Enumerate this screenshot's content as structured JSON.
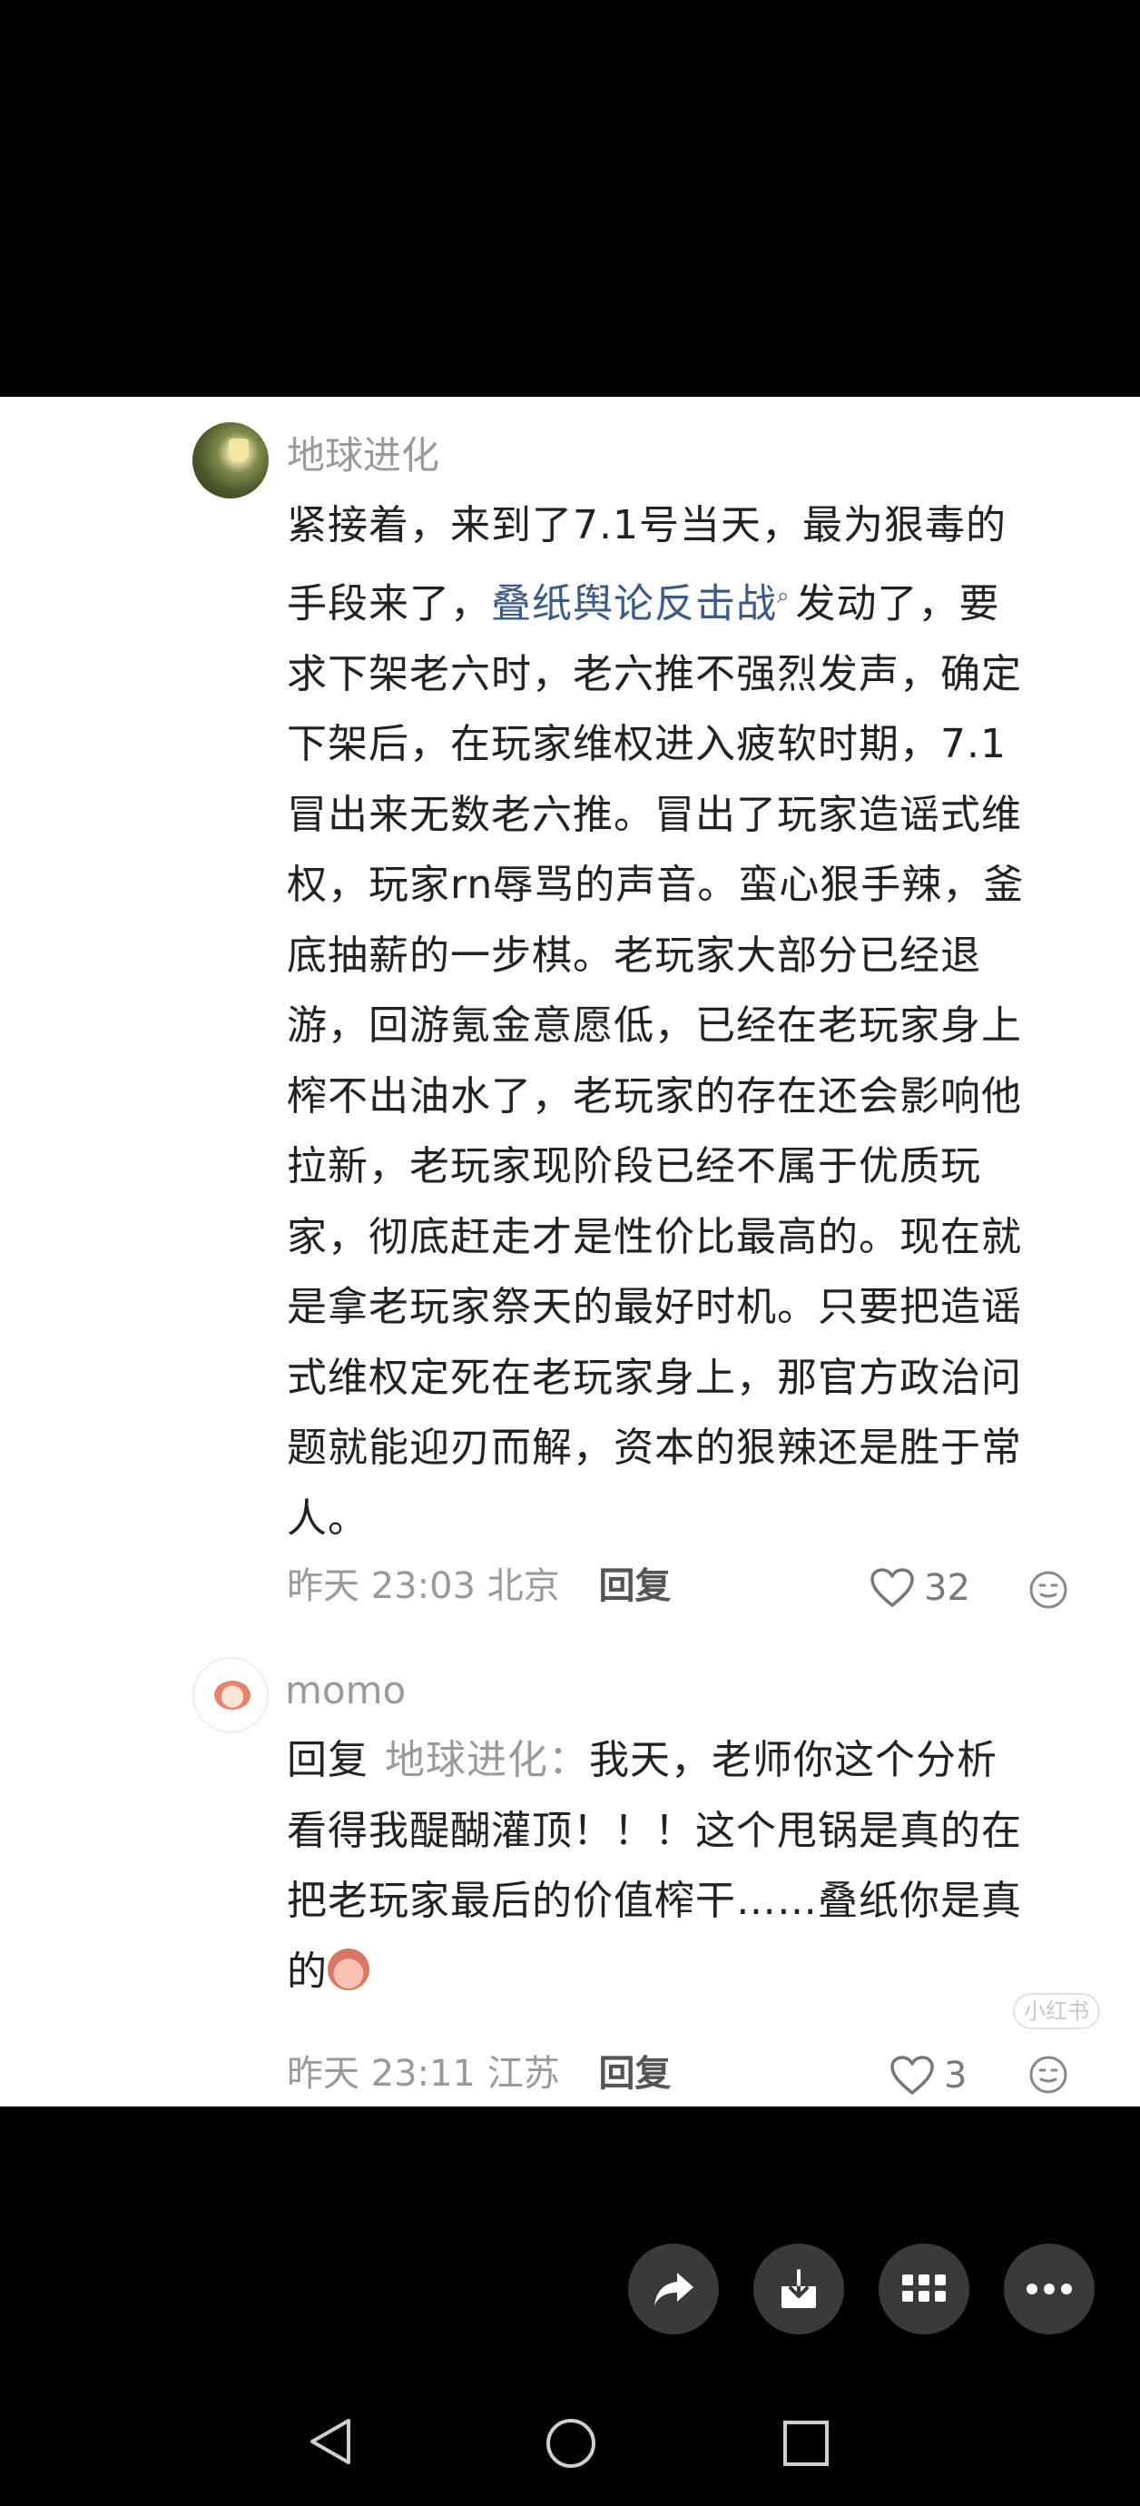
{
  "comment_1": {
    "username": "地球进化",
    "lines_before_link": [
      "紧接着，来到了7.1号当天，最为狠毒的"
    ],
    "link_prefix": "手段来了，",
    "link_text": "叠纸舆论反击战",
    "link_suffix": "发动了，要",
    "lines_after": [
      "求下架老六时，老六推不强烈发声，确定",
      "下架后，在玩家维权进入疲软时期，7.1",
      "冒出来无数老六推。冒出了玩家造谣式维",
      "权，玩家rn辱骂的声音。蛮心狠手辣，釜",
      "底抽薪的一步棋。老玩家大部分已经退",
      "游，回游氪金意愿低，已经在老玩家身上",
      "榨不出油水了，老玩家的存在还会影响他",
      "拉新，老玩家现阶段已经不属于优质玩",
      "家，彻底赶走才是性价比最高的。现在就",
      "是拿老玩家祭天的最好时机。只要把造谣",
      "式维权定死在老玩家身上，那官方政治问",
      "题就能迎刃而解，资本的狠辣还是胜于常",
      "人。"
    ],
    "time": "昨天 23:03",
    "location": "北京",
    "reply_label": "回复",
    "likes": "32"
  },
  "comment_2": {
    "username": "momo",
    "reply_prefix": "回复",
    "reply_target": "地球进化：",
    "line_1_rest": "我天，老师你这个分析",
    "line_2": "看得我醍醐灌顶！！！这个甩锅是真的在",
    "line_3": "把老玩家最后的价值榨干……叠纸你是真",
    "line_4": "的",
    "time": "昨天 23:11",
    "location": "江苏",
    "reply_label": "回复",
    "likes": "3"
  },
  "watermark": {
    "logo": "小红书"
  },
  "icons": {
    "link": "search-icon",
    "like": "heart-outline-icon",
    "react": "emoji-icon",
    "share": "share-arrow-icon",
    "download": "download-icon",
    "apps": "grid-icon",
    "more": "more-dots-icon",
    "nav_back": "nav-back-icon",
    "nav_home": "nav-home-icon",
    "nav_recent": "nav-recent-icon"
  },
  "colors": {
    "link": "#3b5a88",
    "fab_bg": "#3a3a3a",
    "muted": "#9a9a9a"
  }
}
